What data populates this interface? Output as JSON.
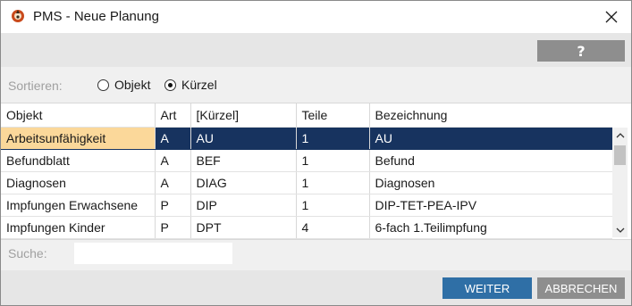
{
  "window": {
    "title": "PMS - Neue Planung",
    "icon": "app-logo-icon"
  },
  "toolbar": {
    "help_label": "?"
  },
  "sort": {
    "label": "Sortieren:",
    "options": [
      {
        "label": "Objekt",
        "checked": false
      },
      {
        "label": "Kürzel",
        "checked": true
      }
    ]
  },
  "table": {
    "columns": [
      "Objekt",
      "Art",
      "[Kürzel]",
      "Teile",
      "Bezeichnung"
    ],
    "rows": [
      [
        "Arbeitsunfähigkeit",
        "A",
        "AU",
        "1",
        "AU"
      ],
      [
        "Befundblatt",
        "A",
        "BEF",
        "1",
        "Befund"
      ],
      [
        "Diagnosen",
        "A",
        "DIAG",
        "1",
        "Diagnosen"
      ],
      [
        "Impfungen Erwachsene",
        "P",
        "DIP",
        "1",
        "DIP-TET-PEA-IPV"
      ],
      [
        "Impfungen Kinder",
        "P",
        "DPT",
        "4",
        "6-fach 1.Teilimpfung"
      ]
    ],
    "selected_row": 0
  },
  "search": {
    "label": "Suche:",
    "value": ""
  },
  "footer": {
    "next_label": "WEITER",
    "cancel_label": "ABBRECHEN"
  },
  "colors": {
    "selection": "#17335f",
    "highlight": "#fbd89a",
    "primary_button": "#2f6fa6",
    "secondary_button": "#8e8e8e"
  }
}
